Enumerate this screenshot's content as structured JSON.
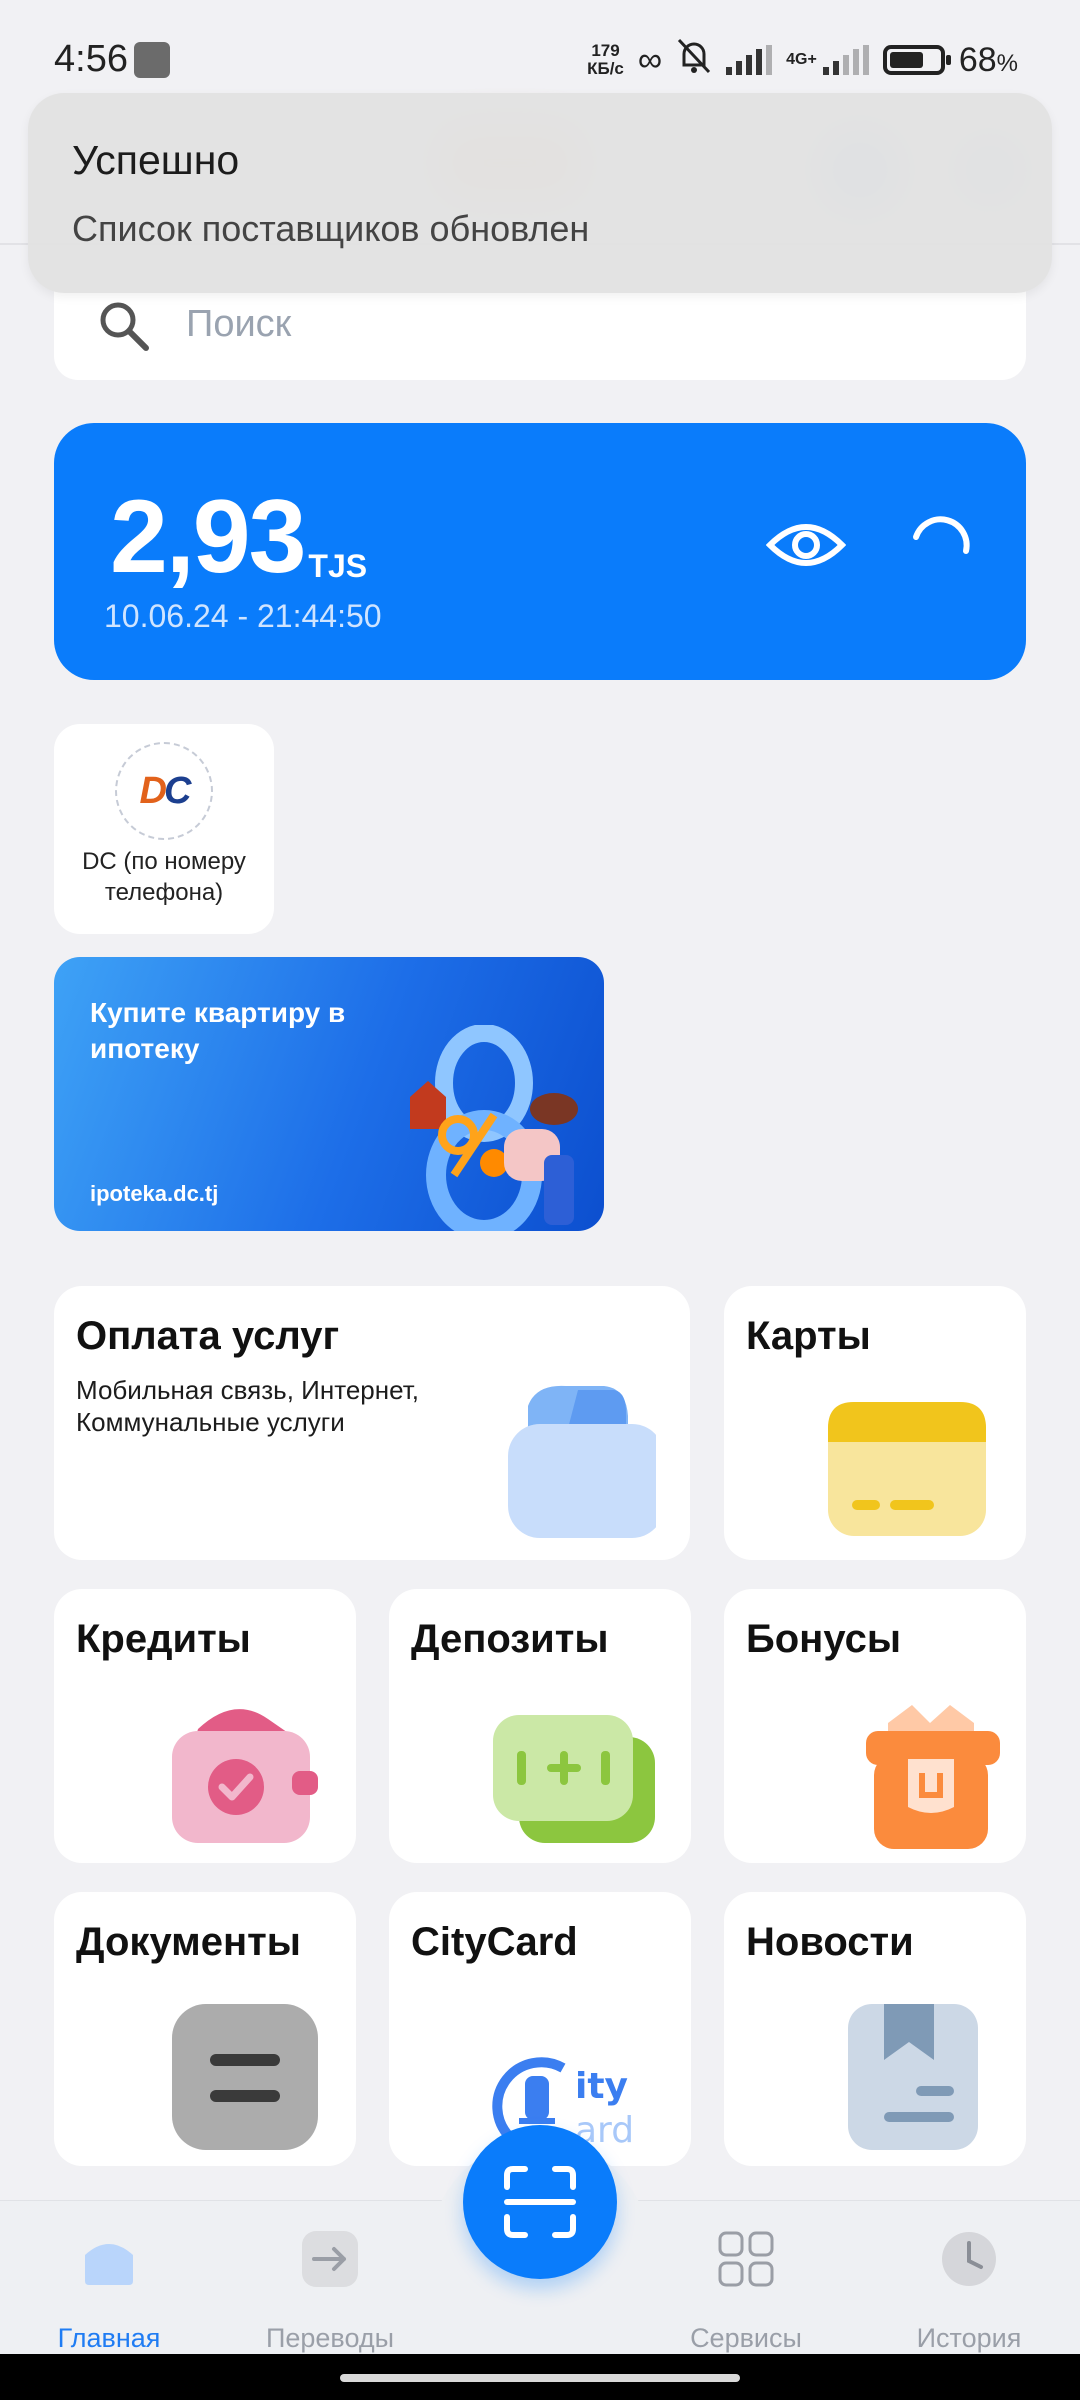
{
  "status_bar": {
    "time": "4:56",
    "net_speed_value": "179",
    "net_speed_unit": "КБ/с",
    "network_type": "4G+",
    "battery_value": "68",
    "battery_unit": "%"
  },
  "toast": {
    "title": "Успешно",
    "message": "Список поставщиков обновлен"
  },
  "search": {
    "placeholder": "Поиск",
    "value": ""
  },
  "balance": {
    "amount": "2,93",
    "currency": "TJS",
    "updated": "10.06.24 - 21:44:50"
  },
  "provider": {
    "label": "DC (по номеру телефона)"
  },
  "banner": {
    "title": "Купите квартиру в ипотеку",
    "link": "ipoteka.dc.tj"
  },
  "tiles": {
    "payments": {
      "title": "Оплата услуг",
      "subtitle": "Мобильная связь, Интернет, Коммунальные услуги"
    },
    "cards": {
      "title": "Карты"
    },
    "credits": {
      "title": "Кредиты"
    },
    "deposits": {
      "title": "Депозиты"
    },
    "bonuses": {
      "title": "Бонусы"
    },
    "documents": {
      "title": "Документы"
    },
    "citycard": {
      "title": "CityCard"
    },
    "news": {
      "title": "Новости"
    }
  },
  "bottom_nav": {
    "home": "Главная",
    "transfers": "Переводы",
    "services": "Сервисы",
    "history": "История"
  },
  "colors": {
    "accent": "#0a7cfb",
    "nav_active": "#1f7cf3",
    "background": "#f1f1f4"
  }
}
